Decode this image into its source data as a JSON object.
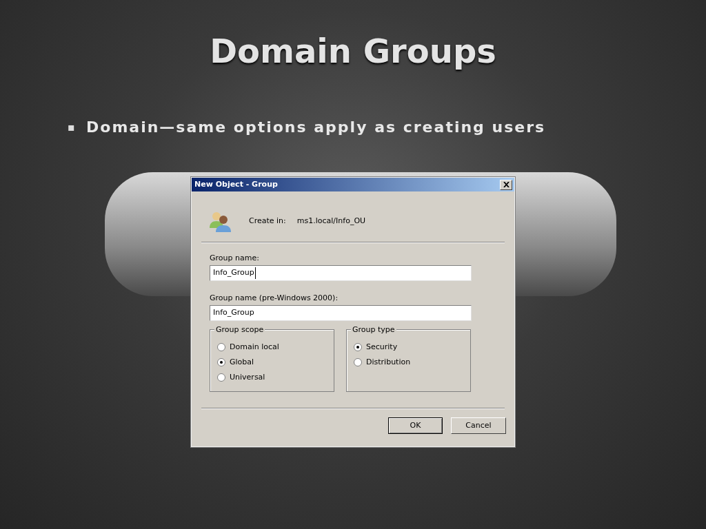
{
  "slide": {
    "title": "Domain Groups",
    "bullets": [
      {
        "marker": "▪",
        "text": "Domain—same options apply as creating users"
      }
    ]
  },
  "dialog": {
    "title": "New Object - Group",
    "create_in": {
      "label": "Create in:",
      "value": "ms1.local/Info_OU"
    },
    "fields": [
      {
        "label": "Group name:",
        "value": "Info_Group",
        "focused": true
      },
      {
        "label": "Group name (pre-Windows 2000):",
        "value": "Info_Group",
        "focused": false
      }
    ],
    "groups": [
      {
        "title": "Group scope",
        "options": [
          {
            "label": "Domain local",
            "selected": false
          },
          {
            "label": "Global",
            "selected": true
          },
          {
            "label": "Universal",
            "selected": false
          }
        ]
      },
      {
        "title": "Group type",
        "options": [
          {
            "label": "Security",
            "selected": true
          },
          {
            "label": "Distribution",
            "selected": false
          }
        ]
      }
    ],
    "buttons": [
      {
        "label": "OK",
        "default": true
      },
      {
        "label": "Cancel",
        "default": false
      }
    ]
  }
}
